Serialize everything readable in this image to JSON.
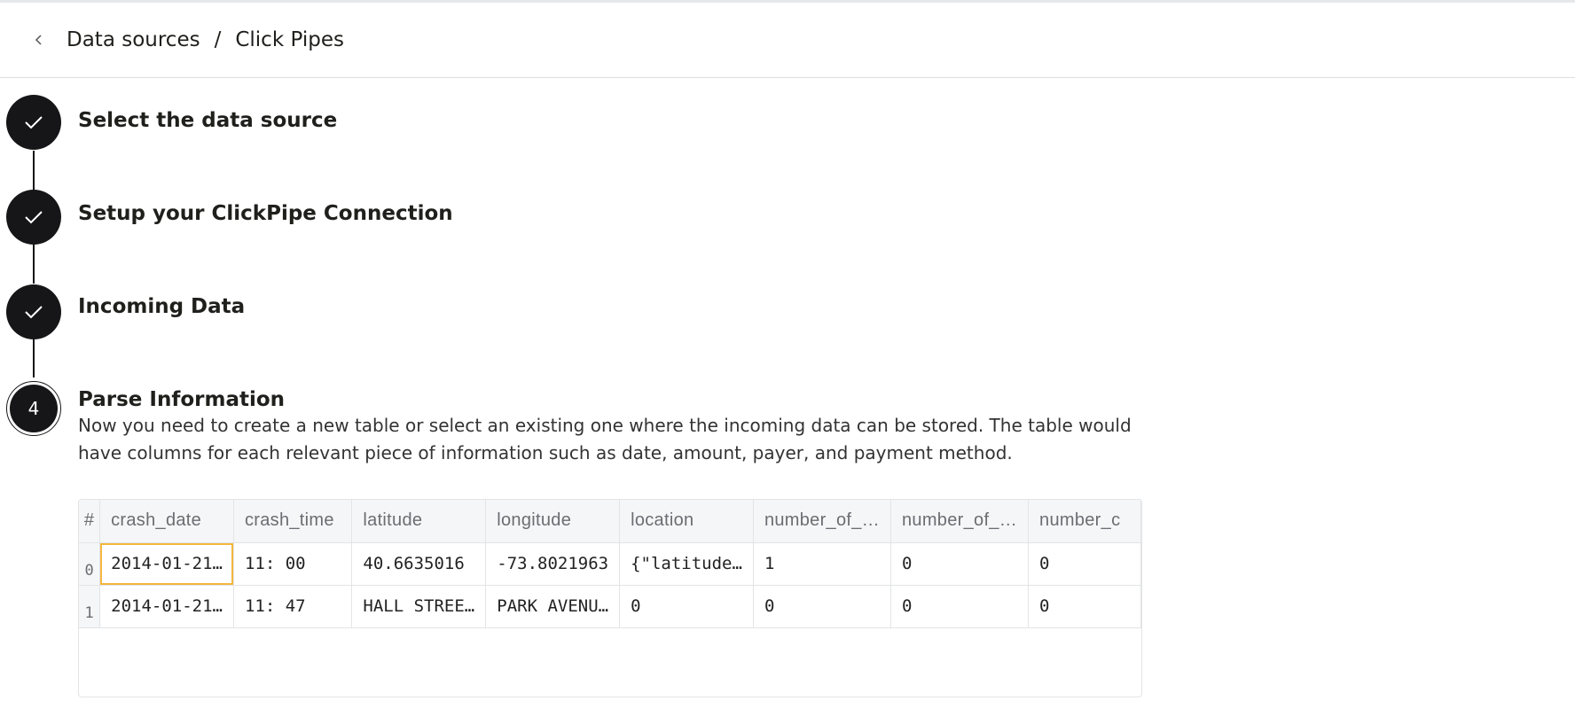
{
  "header": {
    "back_label": "<",
    "breadcrumb": [
      "Data sources",
      "/",
      "Click Pipes"
    ]
  },
  "steps": [
    {
      "title": "Select the data source",
      "status": "done",
      "icon": "check-icon"
    },
    {
      "title": "Setup your ClickPipe Connection",
      "status": "done",
      "icon": "check-icon"
    },
    {
      "title": "Incoming Data",
      "status": "done",
      "icon": "check-icon"
    },
    {
      "title": "Parse Information",
      "status": "current",
      "number": "4",
      "description": "Now you need to create a new table or select an existing one where the incoming data can be stored. The table would have columns for each relevant piece of information such as date, amount, payer, and payment method."
    }
  ],
  "table": {
    "index_header": "#",
    "columns": [
      "crash_date",
      "crash_time",
      "latitude",
      "longitude",
      "location",
      "number_of_…",
      "number_of_…",
      "number_c"
    ],
    "rows": [
      {
        "index": "0",
        "cells": [
          "2014-01-21…",
          "11: 00",
          "40.6635016",
          "-73.8021963",
          "{\"latitude…",
          "1",
          "0",
          "0"
        ]
      },
      {
        "index": "1",
        "cells": [
          "2014-01-21…",
          "11: 47",
          "HALL STREE…",
          "PARK AVENU…",
          "0",
          "0",
          "0",
          "0"
        ]
      }
    ]
  },
  "colors": {
    "step_dark": "#161517",
    "selection": "#f4b73f"
  }
}
